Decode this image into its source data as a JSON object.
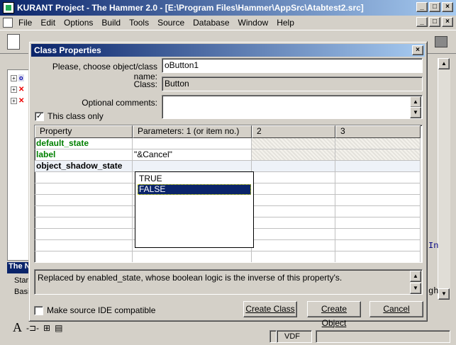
{
  "window": {
    "title": "KURANT Project - The Hammer 2.0 - [E:\\Program Files\\Hammer\\AppSrc\\Atabtest2.src]",
    "min": "_",
    "max": "□",
    "close": "×"
  },
  "menu": [
    "File",
    "Edit",
    "Options",
    "Build",
    "Tools",
    "Source",
    "Database",
    "Window",
    "Help"
  ],
  "background": {
    "tree_nodes": [
      {
        "text": "o",
        "kind": "node"
      },
      {
        "text": "",
        "kind": "x"
      },
      {
        "text": "",
        "kind": "x"
      }
    ],
    "left_header": "The N",
    "left_items": [
      "Star",
      "Basi"
    ],
    "code_snippets": [
      "In",
      "gh"
    ],
    "status_vdf": "VDF"
  },
  "dialog": {
    "title": "Class Properties",
    "close": "×",
    "object_label": "Please, choose object/class name:",
    "object_value": "oButton1",
    "class_label": "Class:",
    "class_value": "Button",
    "comments_label": "Optional comments:",
    "comments_value": "",
    "this_class_only_label": "This class only",
    "this_class_only_checked": true,
    "grid": {
      "headers": [
        "Property",
        "Parameters: 1 (or item no.)",
        "2",
        "3"
      ],
      "rows": [
        {
          "property": "default_state",
          "p1": "",
          "p2": "",
          "p3": "",
          "style": "green"
        },
        {
          "property": "label",
          "p1": "\"&Cancel\"",
          "p2": "",
          "p3": "",
          "style": "green"
        },
        {
          "property": "object_shadow_state",
          "p1": "",
          "p2": "",
          "p3": "",
          "style": "bold"
        }
      ]
    },
    "dropdown_options": [
      "TRUE",
      "FALSE"
    ],
    "dropdown_selected": "FALSE",
    "description": "Replaced by enabled_state, whose boolean logic is the inverse of this property's.",
    "make_source_label": "Make source IDE compatible",
    "make_source_checked": false,
    "buttons": {
      "create_class": "Create Class",
      "create_object": "Create Object",
      "cancel": "Cancel"
    }
  }
}
